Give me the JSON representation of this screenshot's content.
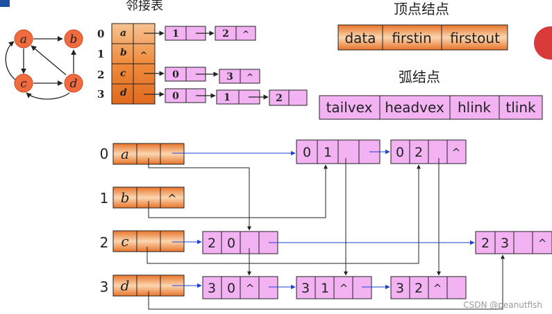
{
  "small_graph": {
    "nodes": [
      "a",
      "b",
      "c",
      "d"
    ]
  },
  "adj_list": {
    "title": "邻接表",
    "indices": [
      "0",
      "1",
      "2",
      "3"
    ],
    "vertices": [
      "a",
      "b",
      "c",
      "d"
    ],
    "null_symbol": "^",
    "row0_edges": [
      "1",
      "2"
    ],
    "row2_edges": [
      "0",
      "3"
    ],
    "row3_edges": [
      "0",
      "1",
      "2"
    ]
  },
  "vertex_node": {
    "title": "顶点结点",
    "fields": [
      "data",
      "firstin",
      "firstout"
    ]
  },
  "arc_node": {
    "title": "弧结点",
    "fields": [
      "tailvex",
      "headvex",
      "hlink",
      "tlink"
    ]
  },
  "ortho": {
    "indices": [
      "0",
      "1",
      "2",
      "3"
    ],
    "vertices": [
      "a",
      "b",
      "c",
      "d"
    ],
    "null_symbol": "^",
    "arcs": {
      "a01": {
        "tail": "0",
        "head": "1"
      },
      "a02": {
        "tail": "0",
        "head": "2"
      },
      "a20": {
        "tail": "2",
        "head": "0"
      },
      "a23": {
        "tail": "2",
        "head": "3"
      },
      "a30": {
        "tail": "3",
        "head": "0"
      },
      "a31": {
        "tail": "3",
        "head": "1"
      },
      "a32": {
        "tail": "3",
        "head": "2"
      }
    }
  },
  "watermark": "CSDN @peanutfish",
  "colors": {
    "vertex_fill": "#f3a25d",
    "arc_fill": "#f3b3f3",
    "node_circle": "#f26b3e",
    "link_line": "#1f3fd6",
    "stroke": "#222222"
  }
}
